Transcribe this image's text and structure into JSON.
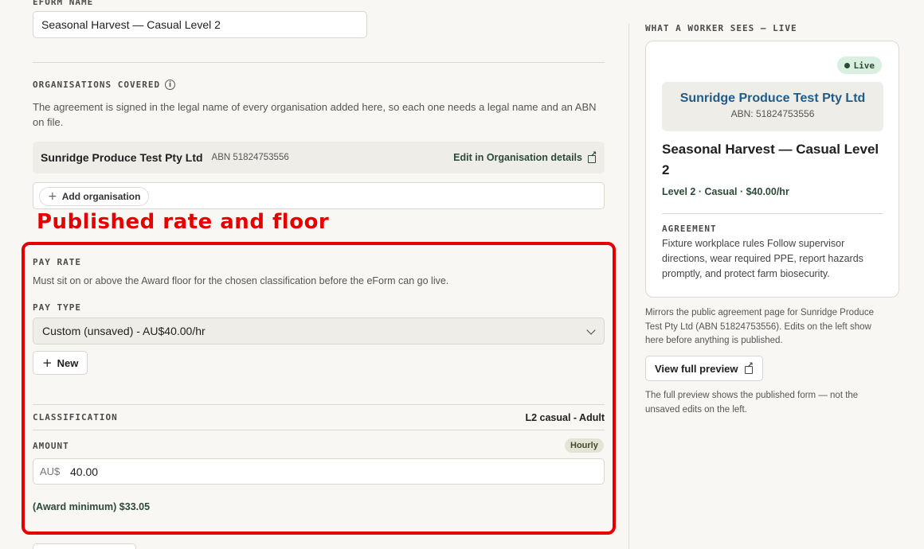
{
  "eform": {
    "name_label": "EFORM NAME",
    "name_value": "Seasonal Harvest — Casual Level 2"
  },
  "organisations": {
    "label": "ORGANISATIONS COVERED",
    "description": "The agreement is signed in the legal name of every organisation added here, so each one needs a legal name and an ABN on file.",
    "items": [
      {
        "name": "Sunridge Produce Test Pty Ltd",
        "abn": "ABN 51824753556",
        "edit_label": "Edit in Organisation details"
      }
    ],
    "add_label": "Add organisation"
  },
  "annotation": {
    "title": "Published rate and floor",
    "color": "#e60000"
  },
  "pay_rate": {
    "label": "PAY RATE",
    "description": "Must sit on or above the Award floor for the chosen classification before the eForm can go live.",
    "pay_type_label": "PAY TYPE",
    "pay_type_value": "Custom (unsaved) - AU$40.00/hr",
    "new_label": "New",
    "classification_label": "CLASSIFICATION",
    "classification_value": "L2 casual - Adult",
    "amount_label": "AMOUNT",
    "amount_badge": "Hourly",
    "amount_prefix": "AU$",
    "amount_value": "40.00",
    "award_minimum": "(Award minimum) $33.05"
  },
  "preview": {
    "heading": "WHAT A WORKER SEES — LIVE",
    "live_badge": "Live",
    "org_name": "Sunridge Produce Test Pty Ltd",
    "org_abn": "ABN: 51824753556",
    "title": "Seasonal Harvest — Casual Level 2",
    "meta": "Level 2 · Casual · $40.00/hr",
    "agreement_label": "AGREEMENT",
    "agreement_text": "Fixture workplace rules Follow supervisor directions, wear required PPE, report hazards promptly, and protect farm biosecurity.",
    "mirror_note": "Mirrors the public agreement page for Sunridge Produce Test Pty Ltd (ABN 51824753556). Edits on the left show here before anything is published.",
    "view_full_label": "View full preview",
    "full_preview_note": "The full preview shows the published form — not the unsaved edits on the left."
  },
  "icons": {
    "info": "info-icon",
    "external": "external-link-icon",
    "plus": "plus-icon",
    "chevron": "chevron-down-icon",
    "live_dot": "status-dot-icon"
  },
  "colors": {
    "accent_green": "#2c4a37",
    "org_blue": "#1f5c8a",
    "live_bg": "#d9efdf",
    "page_bg": "#f8f7f3"
  }
}
